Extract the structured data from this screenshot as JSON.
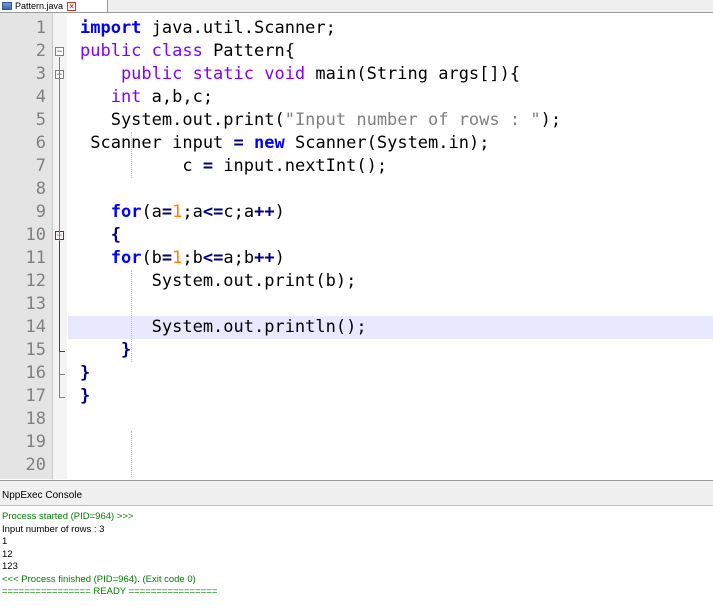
{
  "tab": {
    "filename": "Pattern.java",
    "icon": "file-icon",
    "close": "close-icon"
  },
  "editor": {
    "lines": [
      {
        "n": "1",
        "tokens": [
          {
            "t": "import",
            "c": "kw"
          },
          {
            "t": " java.util.Scanner;",
            "c": ""
          }
        ]
      },
      {
        "n": "2",
        "tokens": [
          {
            "t": "public class",
            "c": "ty"
          },
          {
            "t": " Pattern{",
            "c": ""
          }
        ]
      },
      {
        "n": "3",
        "tokens": [
          {
            "t": "    public static void",
            "c": "ty"
          },
          {
            "t": " main(String args[]){",
            "c": ""
          }
        ]
      },
      {
        "n": "4",
        "tokens": [
          {
            "t": "   int",
            "c": "ty"
          },
          {
            "t": " a,b,c;",
            "c": ""
          }
        ]
      },
      {
        "n": "5",
        "tokens": [
          {
            "t": "   System.out.print(",
            "c": ""
          },
          {
            "t": "\"Input number of rows : \"",
            "c": "str"
          },
          {
            "t": ");",
            "c": ""
          }
        ]
      },
      {
        "n": "6",
        "tokens": [
          {
            "t": " Scanner input ",
            "c": ""
          },
          {
            "t": "=",
            "c": "op"
          },
          {
            "t": " ",
            "c": ""
          },
          {
            "t": "new",
            "c": "kw"
          },
          {
            "t": " Scanner(System.in);",
            "c": ""
          }
        ]
      },
      {
        "n": "7",
        "tokens": [
          {
            "t": "          c ",
            "c": ""
          },
          {
            "t": "=",
            "c": "op"
          },
          {
            "t": " input.nextInt();",
            "c": ""
          }
        ]
      },
      {
        "n": "8",
        "tokens": []
      },
      {
        "n": "9",
        "tokens": [
          {
            "t": "   ",
            "c": ""
          },
          {
            "t": "for",
            "c": "kw"
          },
          {
            "t": "(a",
            "c": ""
          },
          {
            "t": "=",
            "c": "op"
          },
          {
            "t": "1",
            "c": "num"
          },
          {
            "t": ";a",
            "c": ""
          },
          {
            "t": "<=",
            "c": "op"
          },
          {
            "t": "c;a",
            "c": ""
          },
          {
            "t": "++",
            "c": "op"
          },
          {
            "t": ")",
            "c": ""
          }
        ]
      },
      {
        "n": "10",
        "tokens": [
          {
            "t": "   {",
            "c": "op"
          }
        ]
      },
      {
        "n": "11",
        "tokens": [
          {
            "t": "   ",
            "c": ""
          },
          {
            "t": "for",
            "c": "kw"
          },
          {
            "t": "(b",
            "c": ""
          },
          {
            "t": "=",
            "c": "op"
          },
          {
            "t": "1",
            "c": "num"
          },
          {
            "t": ";b",
            "c": ""
          },
          {
            "t": "<=",
            "c": "op"
          },
          {
            "t": "a;b",
            "c": ""
          },
          {
            "t": "++",
            "c": "op"
          },
          {
            "t": ")",
            "c": ""
          }
        ]
      },
      {
        "n": "12",
        "tokens": [
          {
            "t": "       System.out.print(b);",
            "c": ""
          }
        ]
      },
      {
        "n": "13",
        "tokens": []
      },
      {
        "n": "14",
        "tokens": [
          {
            "t": "       System.out.println();",
            "c": ""
          }
        ],
        "current": true
      },
      {
        "n": "15",
        "tokens": [
          {
            "t": "    }",
            "c": "op"
          }
        ]
      },
      {
        "n": "16",
        "tokens": [
          {
            "t": "}",
            "c": "op"
          }
        ]
      },
      {
        "n": "17",
        "tokens": [
          {
            "t": "}",
            "c": "op"
          }
        ]
      },
      {
        "n": "18",
        "tokens": []
      },
      {
        "n": "19",
        "tokens": []
      },
      {
        "n": "20",
        "tokens": []
      }
    ]
  },
  "console": {
    "title": "NppExec Console",
    "lines": [
      {
        "text": "Process started (PID=964) >>>",
        "color": "green"
      },
      {
        "text": "Input number of rows : 3",
        "color": "black"
      },
      {
        "text": "1",
        "color": "black"
      },
      {
        "text": "12",
        "color": "black"
      },
      {
        "text": "123",
        "color": "black"
      },
      {
        "text": "<<< Process finished (PID=964). (Exit code 0)",
        "color": "green"
      },
      {
        "text": "================ READY ================",
        "color": "green"
      }
    ]
  },
  "colors": {
    "keyword": "#0000ff",
    "type": "#8000ff",
    "string": "#808080",
    "number": "#ff8000",
    "operator": "#000080",
    "console_green": "#008000"
  }
}
